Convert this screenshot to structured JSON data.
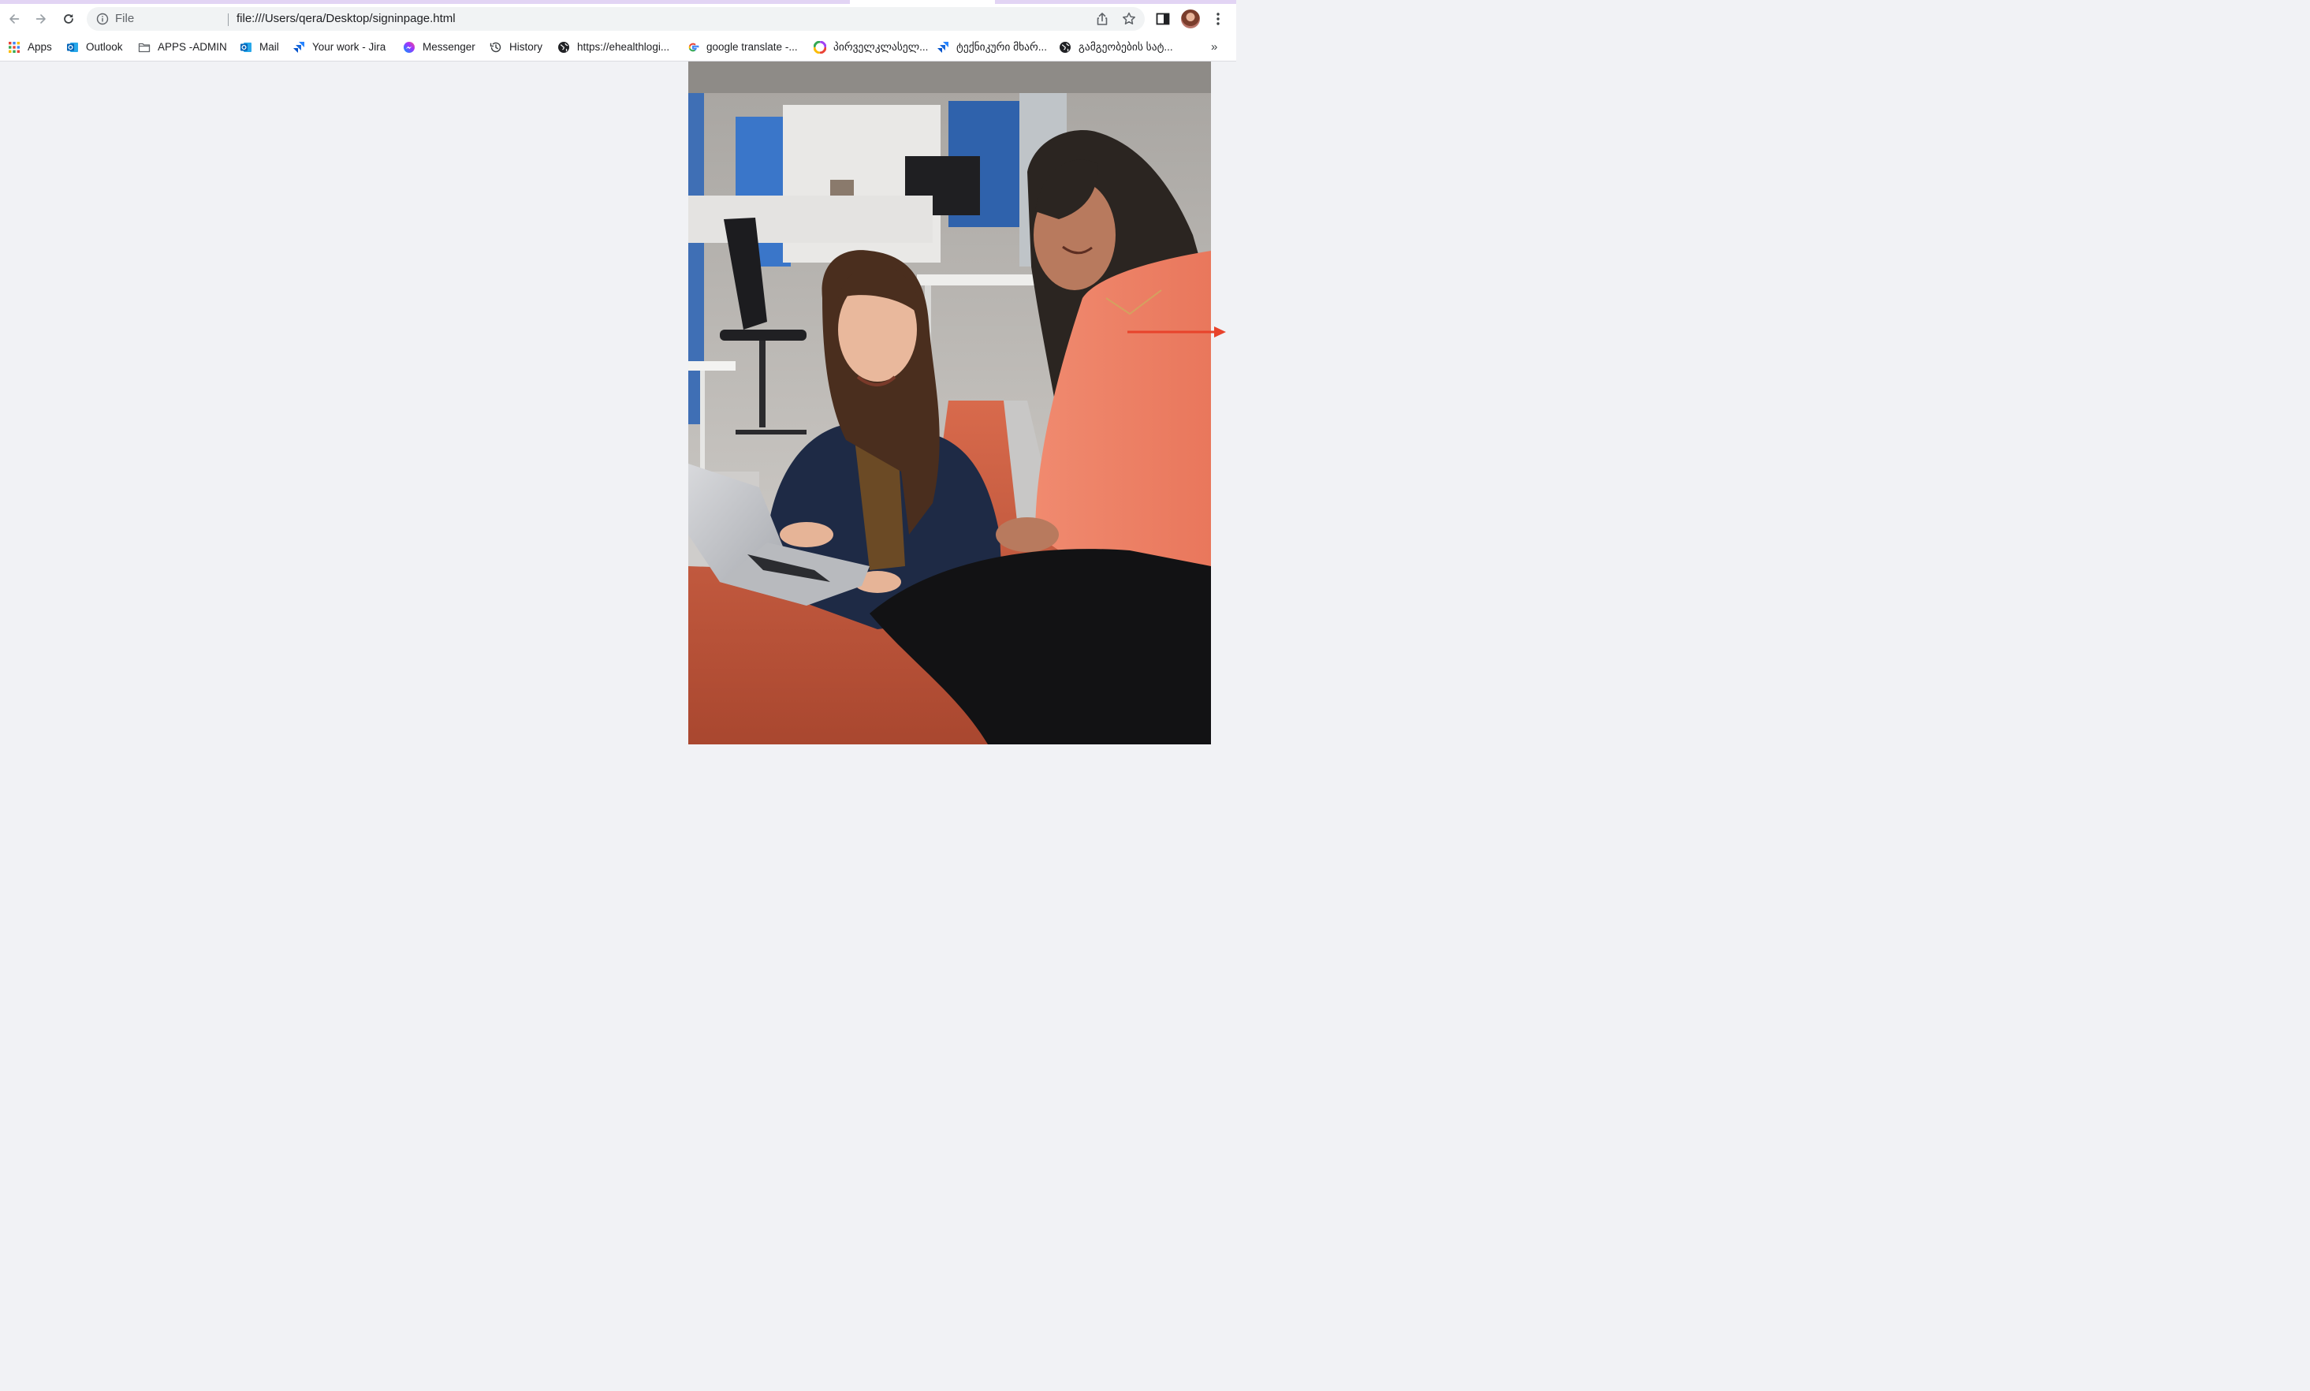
{
  "browser": {
    "address_bar": {
      "scheme_label": "File",
      "url": "file:///Users/qera/Desktop/signinpage.html"
    },
    "icons": {
      "back": "arrow-left-icon",
      "forward": "arrow-right-icon",
      "reload": "reload-icon",
      "info": "info-icon",
      "share": "share-icon",
      "bookmark": "star-icon",
      "side_panel": "side-panel-icon",
      "menu": "kebab-menu-icon"
    }
  },
  "bookmarks": [
    {
      "label": "Apps",
      "icon": "apps-grid-icon"
    },
    {
      "label": "Outlook",
      "icon": "outlook-icon"
    },
    {
      "label": "APPS -ADMIN",
      "icon": "folder-icon"
    },
    {
      "label": "Mail",
      "icon": "outlook-icon"
    },
    {
      "label": "Your work - Jira",
      "icon": "jira-icon"
    },
    {
      "label": "Messenger",
      "icon": "messenger-icon"
    },
    {
      "label": "History",
      "icon": "history-icon"
    },
    {
      "label": "https://ehealthlogi...",
      "icon": "globe-icon"
    },
    {
      "label": "google translate -...",
      "icon": "google-icon"
    },
    {
      "label": "პირველკლასელ...",
      "icon": "colorful-circle-icon"
    },
    {
      "label": "ტექნიკური მხარ...",
      "icon": "jira-icon"
    },
    {
      "label": "გამგეობების სატ...",
      "icon": "globe-icon"
    }
  ],
  "bookmarks_overflow": "»",
  "page": {
    "hero_image": "photo of two smiling women working on a laptop in an office",
    "accent_color": "#e8432b"
  }
}
